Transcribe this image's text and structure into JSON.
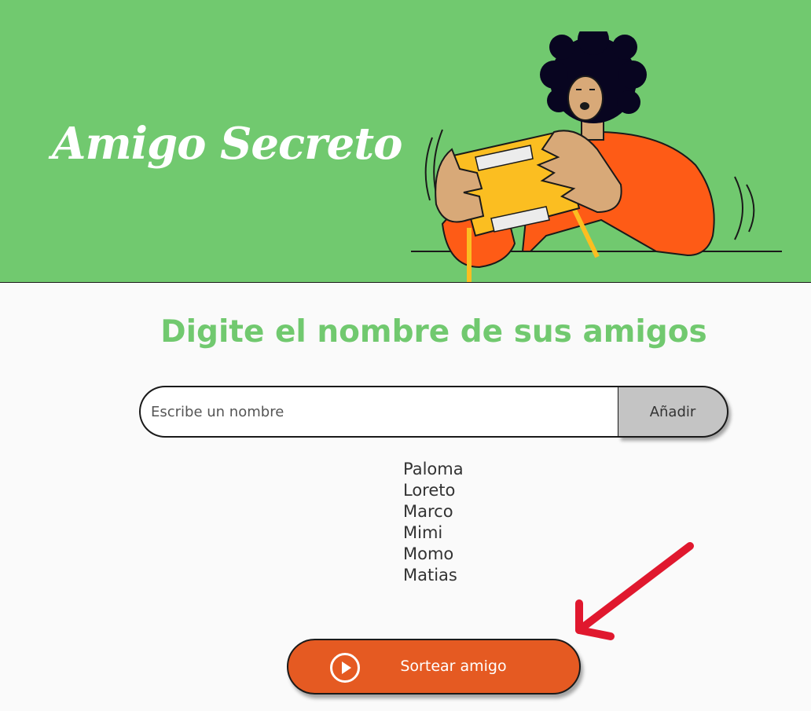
{
  "header": {
    "title": "Amigo Secreto",
    "illustration_icon": "person-holding-gift-box-illustration",
    "background_color": "#71c96f"
  },
  "main": {
    "heading": "Digite el nombre de sus amigos",
    "heading_color": "#71c96f",
    "input": {
      "placeholder": "Escribe un nombre",
      "value": ""
    },
    "add_button_label": "Añadir",
    "friends": [
      "Paloma",
      "Loreto",
      "Marco",
      "Mimi",
      "Momo",
      "Matias"
    ],
    "draw_button": {
      "label": "Sortear amigo",
      "icon": "play-circle-icon",
      "color": "#e55a22"
    },
    "annotation_arrow": {
      "icon": "red-arrow-icon",
      "color": "#e0182e"
    }
  }
}
